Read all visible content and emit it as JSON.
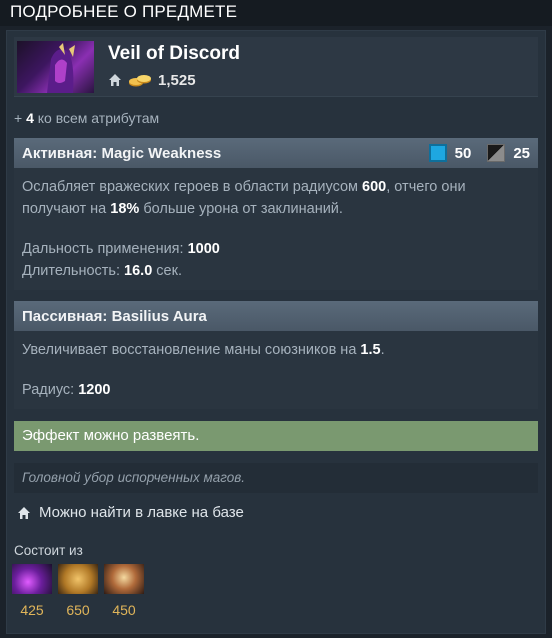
{
  "header": {
    "title": "ПОДРОБНЕЕ О ПРЕДМЕТЕ"
  },
  "item": {
    "name": "Veil of Discord",
    "cost": "1,525",
    "icon": "veil-of-discord-icon",
    "bonus_prefix": "+",
    "bonus_value": "4",
    "bonus_text": "ко всем атрибутам"
  },
  "active": {
    "title": "Активная: Magic Weakness",
    "mana": "50",
    "cooldown": "25",
    "desc_a": "Ослабляет вражеских героев в области радиусом ",
    "desc_b": "600",
    "desc_c": ", отчего они получают на ",
    "desc_d": "18%",
    "desc_e": " больше урона от заклинаний.",
    "range_label": "Дальность применения: ",
    "range_value": "1000",
    "duration_label": "Длительность: ",
    "duration_value": "16.0",
    "duration_unit": " сек."
  },
  "passive": {
    "title": "Пассивная: Basilius Aura",
    "desc_a": "Увеличивает восстановление маны союзников на ",
    "desc_b": "1.5",
    "desc_c": ".",
    "radius_label": "Радиус: ",
    "radius_value": "1200"
  },
  "dispel": "Эффект можно развеять.",
  "lore": "Головной убор испорченных магов.",
  "shop": "Можно найти в лавке на базе",
  "components": {
    "label": "Состоит из",
    "items": [
      {
        "icon": "crown-icon",
        "cost": "425"
      },
      {
        "icon": "scroll-icon",
        "cost": "650"
      },
      {
        "icon": "basilius-icon",
        "cost": "450"
      }
    ]
  },
  "colors": {
    "mana": "#1ea7e1",
    "dispel_bg": "#7a9970",
    "gold_text": "#e0b55a"
  }
}
